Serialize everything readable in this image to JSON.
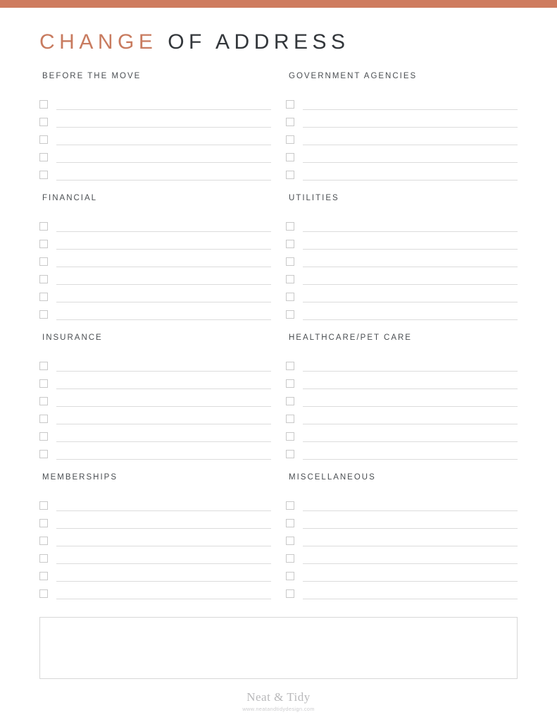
{
  "document": {
    "title_accent": "CHANGE",
    "title_rest": " OF ADDRESS",
    "accent_color": "#ce7b5e",
    "title_dark_color": "#33373b"
  },
  "sections": [
    {
      "id": "before-the-move",
      "title": "BEFORE THE MOVE",
      "column": "left",
      "rows": 5
    },
    {
      "id": "government-agencies",
      "title": "GOVERNMENT AGENCIES",
      "column": "right",
      "rows": 5
    },
    {
      "id": "financial",
      "title": "FINANCIAL",
      "column": "left",
      "rows": 6
    },
    {
      "id": "utilities",
      "title": "UTILITIES",
      "column": "right",
      "rows": 6
    },
    {
      "id": "insurance",
      "title": "INSURANCE",
      "column": "left",
      "rows": 6
    },
    {
      "id": "healthcare-pet-care",
      "title": "HEALTHCARE/PET CARE",
      "column": "right",
      "rows": 6
    },
    {
      "id": "memberships",
      "title": "MEMBERSHIPS",
      "column": "left",
      "rows": 6
    },
    {
      "id": "miscellaneous",
      "title": "MISCELLANEOUS",
      "column": "right",
      "rows": 6
    }
  ],
  "notes": {
    "value": "",
    "placeholder": ""
  },
  "footer": {
    "brand": "Neat & Tidy",
    "url": "www.neatandtidydesign.com"
  }
}
